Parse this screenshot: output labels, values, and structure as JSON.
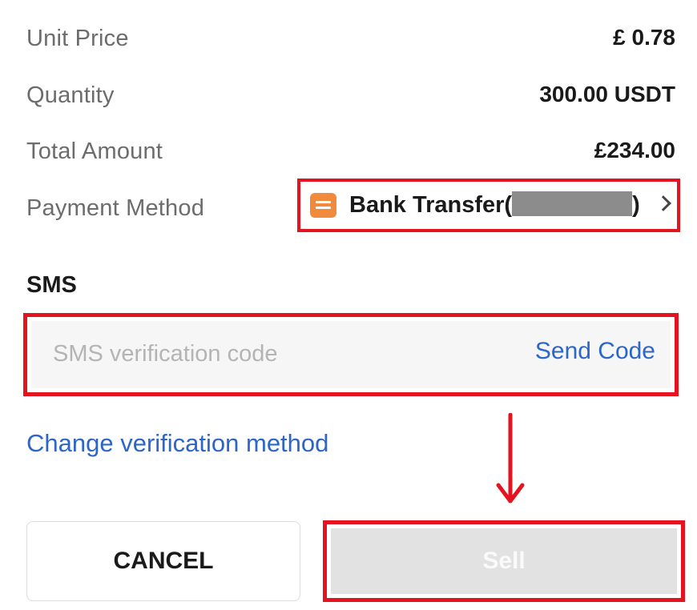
{
  "order": {
    "unit_price_label": "Unit Price",
    "unit_price_value": "£ 0.78",
    "quantity_label": "Quantity",
    "quantity_value": "300.00 USDT",
    "total_label": "Total Amount",
    "total_value": "£234.00",
    "payment_label": "Payment Method",
    "payment_prefix": "Bank Transfer(",
    "payment_suffix": ")",
    "payment_icon": "bank-card-icon"
  },
  "sms": {
    "heading": "SMS",
    "placeholder": "SMS verification code",
    "value": "",
    "send_code": "Send Code"
  },
  "change_method": "Change verification method",
  "actions": {
    "cancel": "CANCEL",
    "sell": "Sell"
  },
  "colors": {
    "highlight": "#e3141f",
    "link": "#2c66c8",
    "payment_icon": "#f28a3b",
    "disabled_button": "#e2e2e2"
  }
}
